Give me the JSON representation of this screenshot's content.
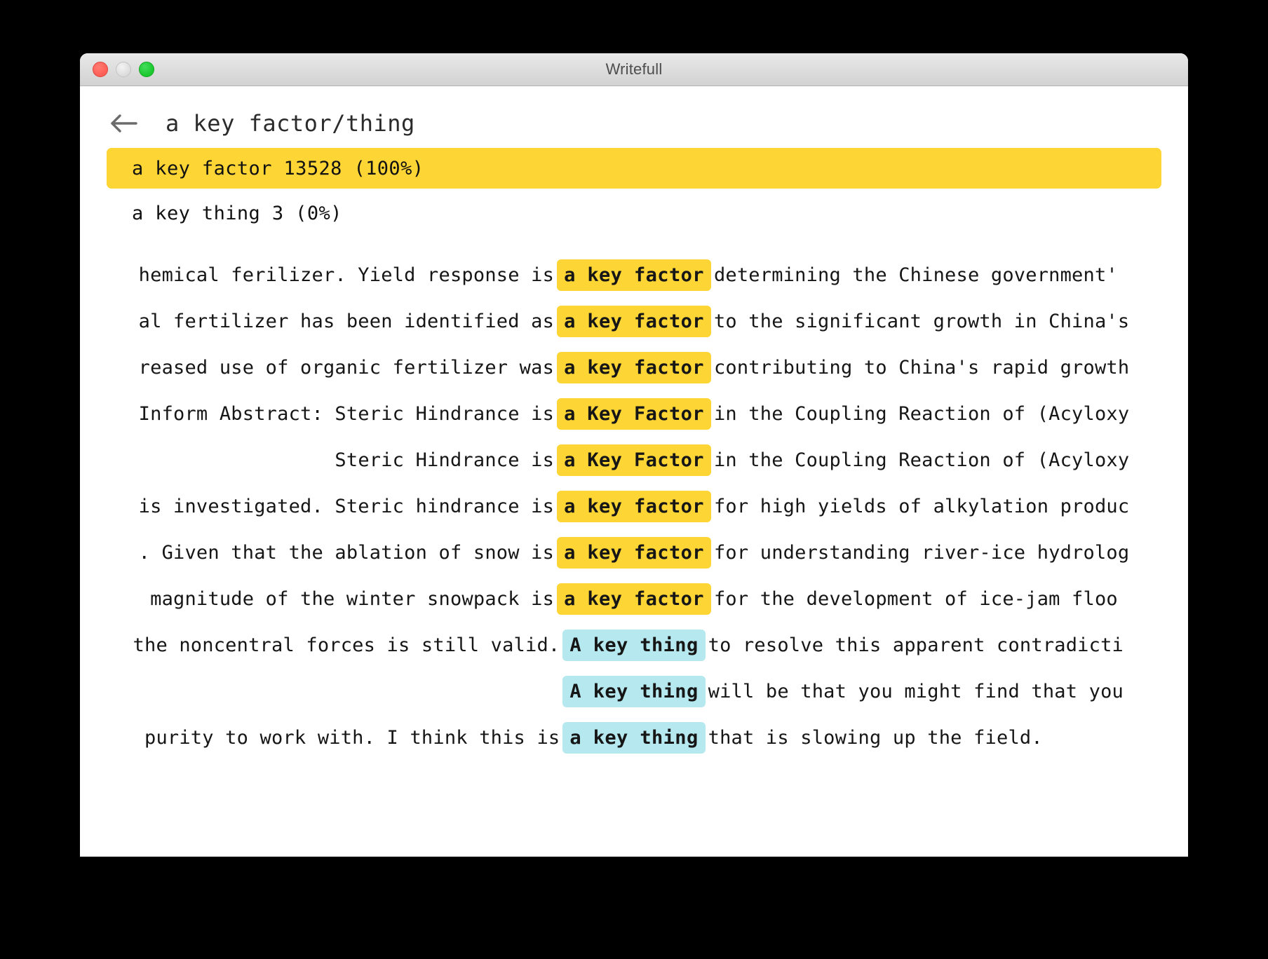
{
  "window": {
    "title": "Writefull",
    "traffic_lights": [
      "close-button",
      "minimize-button",
      "zoom-button"
    ]
  },
  "header": {
    "back_icon": "back-arrow-icon",
    "title": "a key factor/thing"
  },
  "results": [
    {
      "label": "a key factor 13528 (100%)",
      "phrase": "a key factor",
      "count": "13528",
      "percent": "100%",
      "selected": true
    },
    {
      "label": "a key thing 3 (0%)",
      "phrase": "a key thing",
      "count": "3",
      "percent": "0%",
      "selected": false
    }
  ],
  "colors": {
    "highlight_yellow": "#fdd535",
    "highlight_cyan": "#b6e8ef",
    "window_background": "#ffffff",
    "titlebar": "#dcdcdc",
    "page_background": "#000000"
  },
  "examples": [
    {
      "left": "hemical ferilizer. Yield response is",
      "keyword": "a key factor",
      "right": "determining the Chinese government'",
      "highlight": "yellow"
    },
    {
      "left": "al fertilizer has been identified as",
      "keyword": "a key factor",
      "right": "to the significant growth in China's",
      "highlight": "yellow"
    },
    {
      "left": "reased use of organic fertilizer was",
      "keyword": "a key factor",
      "right": "contributing to China's rapid growth",
      "highlight": "yellow"
    },
    {
      "left": "Inform Abstract: Steric Hindrance is",
      "keyword": "a Key Factor",
      "right": "in the Coupling Reaction of (Acyloxy",
      "highlight": "yellow"
    },
    {
      "left": "Steric Hindrance is",
      "keyword": "a Key Factor",
      "right": "in the Coupling Reaction of (Acyloxy",
      "highlight": "yellow"
    },
    {
      "left": "is investigated. Steric hindrance is",
      "keyword": "a key factor",
      "right": "for high yields of alkylation produc",
      "highlight": "yellow"
    },
    {
      "left": ". Given that the ablation of snow is",
      "keyword": "a key factor",
      "right": "for understanding river-ice hydrolog",
      "highlight": "yellow"
    },
    {
      "left": "magnitude of the winter snowpack is",
      "keyword": "a key factor",
      "right": "for the development of ice-jam floo",
      "highlight": "yellow"
    },
    {
      "left": "the noncentral forces is still valid.",
      "keyword": "A key thing",
      "right": "to resolve this apparent contradicti",
      "highlight": "cyan"
    },
    {
      "left": "",
      "keyword": "A key thing",
      "right": "will be that you might find that you",
      "highlight": "cyan"
    },
    {
      "left": "purity to work with. I think this is",
      "keyword": "a key thing",
      "right": "that is slowing up the field.",
      "highlight": "cyan"
    }
  ]
}
